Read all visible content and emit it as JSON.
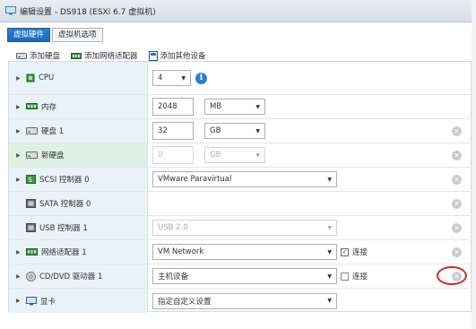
{
  "window": {
    "title": "编辑设置 - DS918 (ESXi 6.7 虚拟机)"
  },
  "tabs": [
    {
      "label": "虚拟硬件"
    },
    {
      "label": "虚拟机选项"
    }
  ],
  "toolbar": {
    "add_disk": "添加硬盘",
    "add_network": "添加网络适配器",
    "add_other": "添加其他设备"
  },
  "rows": {
    "cpu": {
      "label": "CPU",
      "value": "4"
    },
    "memory": {
      "label": "内存",
      "value": "2048",
      "unit": "MB"
    },
    "disk1": {
      "label": "硬盘 1",
      "value": "32",
      "unit": "GB"
    },
    "new_disk": {
      "label": "新硬盘",
      "value": "0",
      "unit": "GB"
    },
    "scsi": {
      "label": "SCSI 控制器 0",
      "value": "VMware Paravirtual"
    },
    "sata": {
      "label": "SATA 控制器 0"
    },
    "usb": {
      "label": "USB 控制器 1",
      "value": "USB 2.0"
    },
    "network": {
      "label": "网络适配器 1",
      "value": "VM Network",
      "connect_label": "连接",
      "connected": true
    },
    "cdrom": {
      "label": "CD/DVD 驱动器 1",
      "value": "主机设备",
      "connect_label": "连接",
      "connected": false
    },
    "video": {
      "label": "显卡",
      "value": "指定自定义设置"
    }
  },
  "colors": {
    "accent": "#1d68b5",
    "highlight_circle": "#c62b2b"
  }
}
